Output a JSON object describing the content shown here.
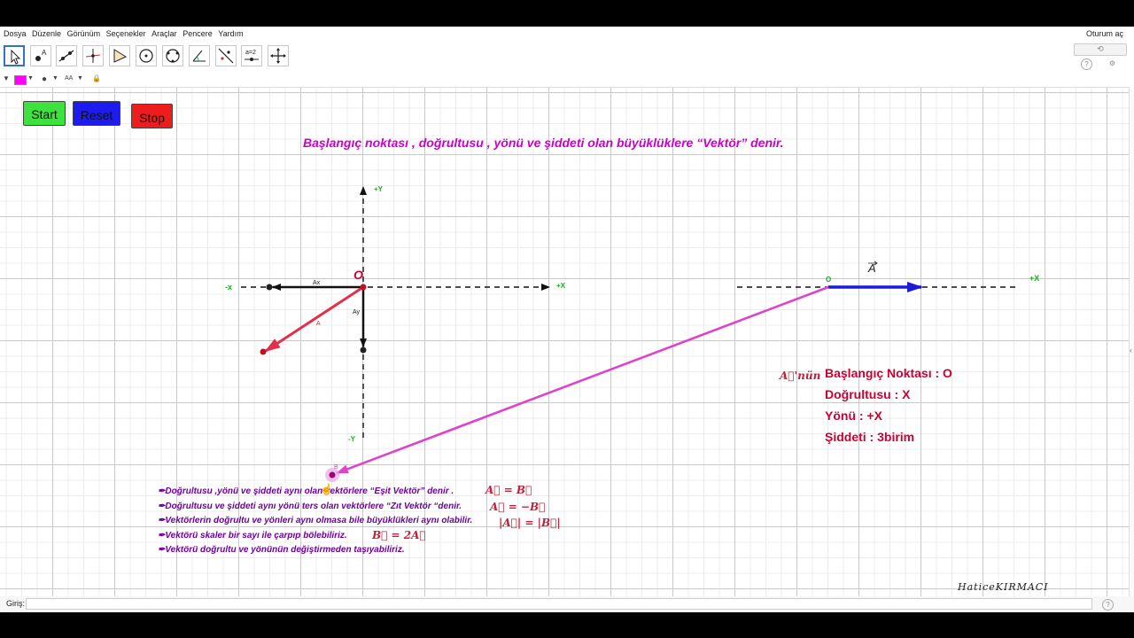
{
  "menu": [
    "Dosya",
    "Düzenle",
    "Görünüm",
    "Seçenekler",
    "Araçlar",
    "Pencere",
    "Yardım"
  ],
  "login": "Oturum aç",
  "tools": [
    "move-tool",
    "point-tool",
    "line-tool",
    "perpendicular-tool",
    "polygon-tool",
    "circle-tool",
    "conic-tool",
    "angle-tool",
    "reflect-tool",
    "slider-tool",
    "move-view-tool"
  ],
  "slider_label": "a=2",
  "buttons": {
    "start": "Start",
    "reset": "Reset",
    "stop": "Stop"
  },
  "colors": {
    "start": "#3ee23e",
    "reset": "#1c1cf0",
    "stop": "#ee1c1c",
    "title": "#cc00cc",
    "info": "#cc0033"
  },
  "title": "Başlangıç noktası , doğrultusu , yönü ve şiddeti olan büyüklüklere “Vektör” denir.",
  "axes": {
    "y_pos": "+Y",
    "y_neg": "-Y",
    "x_pos": "+X",
    "x_neg": "-x",
    "origin": "O",
    "ax": "Ax",
    "ay": "Ay",
    "a": "A",
    "b": "B",
    "o_small": "O",
    "x_pos_right": "+X"
  },
  "vector_label": "A",
  "info": {
    "prefix": "A⃗'nün",
    "start": "Başlangıç Noktası :  O",
    "direction": "Doğrultusu : X",
    "sense": "Yönü : +X",
    "magnitude": "Şiddeti :  3birim"
  },
  "bullets": [
    "✒Doğrultusu ,yönü ve şiddeti aynı olan vektörlere “Eşit Vektör” denir .",
    "✒Doğrultusu ve şiddeti aynı yönü ters olan vektörlere “Zıt Vektör “denir.",
    "✒Vektörlerin doğrultu ve yönleri aynı olmasa bile büyüklükleri aynı olabilir.",
    "✒Vektörü skaler bir sayı ile çarpıp bölebiliriz.",
    "✒Vektörü doğrultu ve yönünün değiştirmeden taşıyabiliriz."
  ],
  "formulas": [
    "A⃗ = B⃗",
    "A⃗ = −B⃗",
    "|A⃗| = |B⃗|",
    "B⃗ = 2A⃗"
  ],
  "signature": "HaticeKIRMACI",
  "input_label": "Giriş:"
}
